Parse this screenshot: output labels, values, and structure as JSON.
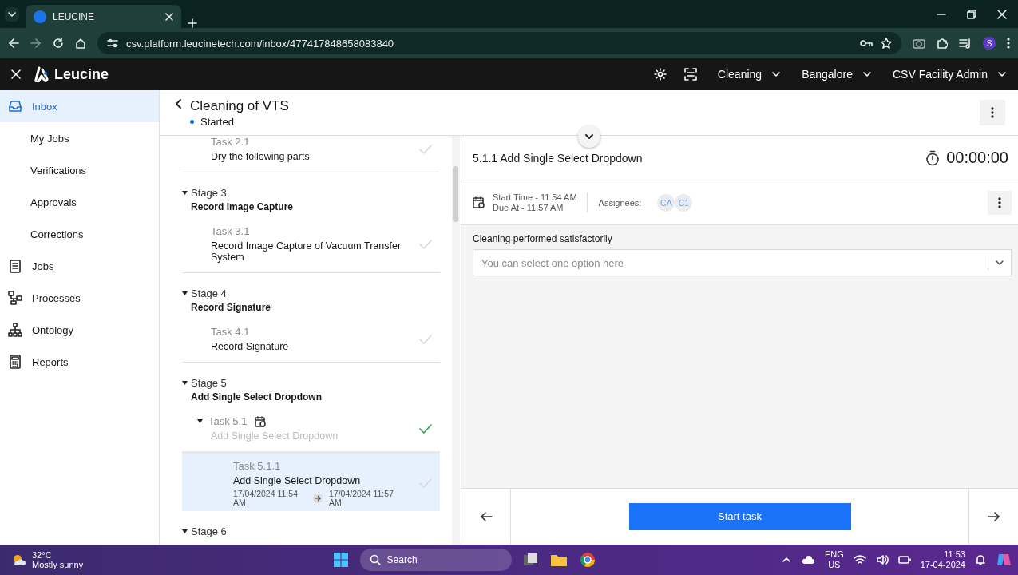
{
  "browser": {
    "tab_title": "LEUCINE",
    "url": "csv.platform.leucinetech.com/inbox/477417848658083840",
    "profile_initial": "S"
  },
  "app_header": {
    "brand": "Leucine",
    "menus": [
      "Cleaning",
      "Bangalore",
      "CSV Facility Admin"
    ]
  },
  "sidebar": {
    "items": [
      {
        "label": "Inbox",
        "kind": "inbox",
        "selected": true
      },
      {
        "label": "My Jobs",
        "kind": "sub",
        "selected": false
      },
      {
        "label": "Verifications",
        "kind": "sub",
        "selected": false
      },
      {
        "label": "Approvals",
        "kind": "sub",
        "selected": false
      },
      {
        "label": "Corrections",
        "kind": "sub",
        "selected": false
      },
      {
        "label": "Jobs",
        "kind": "jobs",
        "selected": false
      },
      {
        "label": "Processes",
        "kind": "processes",
        "selected": false
      },
      {
        "label": "Ontology",
        "kind": "ontology",
        "selected": false
      },
      {
        "label": "Reports",
        "kind": "reports",
        "selected": false
      }
    ]
  },
  "job": {
    "title": "Cleaning of VTS",
    "status": "Started"
  },
  "stages": [
    {
      "tasks": [
        {
          "number": "Task 2.1",
          "name": "Dry the following parts",
          "completed": false,
          "selected": false,
          "disabled": false,
          "scheduled": false
        }
      ]
    },
    {
      "label": "Stage 3",
      "name": "Record Image Capture",
      "expanded": true,
      "tasks": [
        {
          "number": "Task 3.1",
          "name": "Record Image Capture of Vacuum Transfer System",
          "completed": false,
          "selected": false,
          "disabled": false,
          "scheduled": false
        }
      ]
    },
    {
      "label": "Stage 4",
      "name": "Record Signature",
      "expanded": true,
      "tasks": [
        {
          "number": "Task 4.1",
          "name": "Record Signature",
          "completed": false,
          "selected": false,
          "disabled": false,
          "scheduled": false
        }
      ]
    },
    {
      "label": "Stage 5",
      "name": "Add Single Select Dropdown",
      "expanded": true,
      "tasks": [
        {
          "number": "Task 5.1",
          "name": "Add Single Select Dropdown",
          "completed": true,
          "selected": false,
          "disabled": true,
          "scheduled": true,
          "expanded": true,
          "children": [
            {
              "number": "Task 5.1.1",
              "name": "Add Single Select Dropdown",
              "completed": false,
              "selected": true,
              "disabled": false,
              "scheduled": false,
              "start": "17/04/2024 11:54 AM",
              "due": "17/04/2024 11:57 AM"
            }
          ]
        }
      ]
    },
    {
      "label": "Stage 6",
      "expanded": true
    }
  ],
  "task_detail": {
    "title": "5.1.1 Add Single Select Dropdown",
    "timer": "00:00:00",
    "start_time": "Start Time - 11.54 AM",
    "due_at": "Due At - 11.57 AM",
    "assignees_label": "Assignees:",
    "assignees": [
      "CA",
      "C1"
    ],
    "parameter": {
      "label": "Cleaning performed satisfactorily",
      "placeholder": "You can select one option here"
    },
    "primary_button": "Start task"
  },
  "taskbar": {
    "temperature": "32°C",
    "weather": "Mostly sunny",
    "search_placeholder": "Search",
    "language": "ENG",
    "region": "US",
    "time": "11:53",
    "date": "17-04-2024"
  }
}
